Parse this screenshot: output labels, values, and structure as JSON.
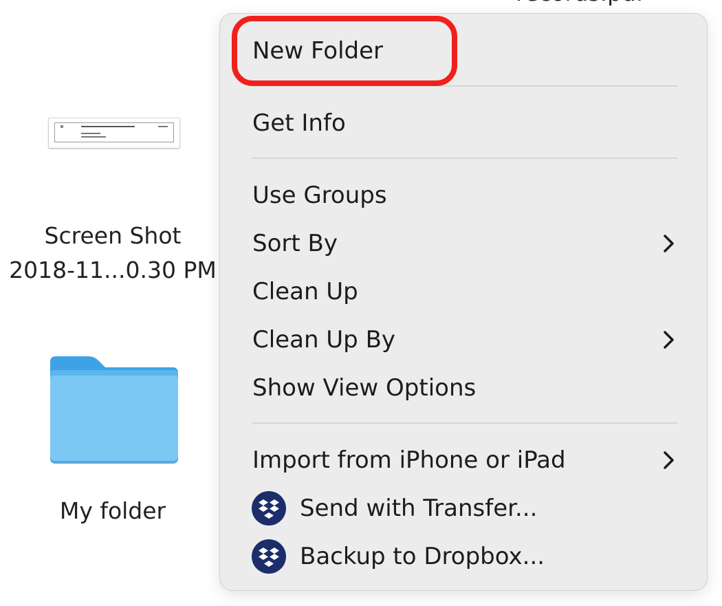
{
  "desktop": {
    "top_file_label": "records.pdf",
    "files": [
      {
        "label_line1": "Screen Shot",
        "label_line2": "2018-11...0.30 PM",
        "icon": "document-thumbnail-icon"
      },
      {
        "label": "My folder",
        "icon": "folder-icon"
      }
    ]
  },
  "context_menu": {
    "items": [
      {
        "label": "New Folder",
        "highlighted": true
      },
      {
        "label": "Get Info"
      },
      {
        "label": "Use Groups"
      },
      {
        "label": "Sort By",
        "submenu": true
      },
      {
        "label": "Clean Up"
      },
      {
        "label": "Clean Up By",
        "submenu": true
      },
      {
        "label": "Show View Options"
      },
      {
        "label": "Import from iPhone or iPad",
        "submenu": true
      },
      {
        "label": "Send with Transfer...",
        "icon": "dropbox-icon"
      },
      {
        "label": "Backup to Dropbox...",
        "icon": "dropbox-icon"
      }
    ]
  },
  "colors": {
    "highlight": "#f0201c",
    "menu_bg": "#ececec",
    "folder_light": "#7cc8f5",
    "folder_dark": "#3ea3e6",
    "dropbox_badge": "#1c2d6b"
  }
}
